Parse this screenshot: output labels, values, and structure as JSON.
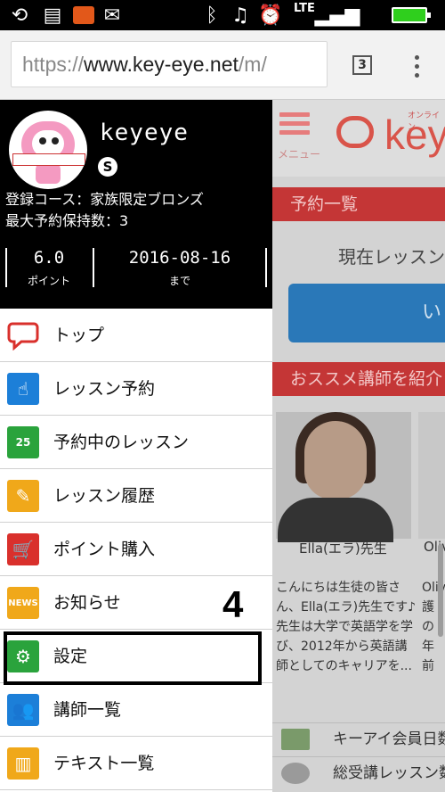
{
  "browser": {
    "url_scheme": "https://",
    "url_host": "www.key-eye.net",
    "url_path": "/m/",
    "tab_count": "3"
  },
  "status_bar": {
    "network": "LTE"
  },
  "background_page": {
    "menu_label": "メニュー",
    "logo_text": "key",
    "logo_small": "オンライン",
    "section_reservations": "予約一覧",
    "current_lesson_text": "現在レッスン",
    "blue_button_text": "い",
    "section_recommended": "おススメ講師を紹介",
    "teacher1_name": "Ella(エラ)先生",
    "teacher2_name": "Oliv",
    "teacher1_desc": "こんにちは生徒の皆さん、Ella(エラ)先生です♪ 先生は大学で英語学を学び、2012年から英語講師としてのキャリアを...",
    "teacher2_desc": "Olive 護の 年前 働い 力が",
    "list_item1": "キーアイ会員日数",
    "list_item2": "総受講レッスン数"
  },
  "profile": {
    "username": "keyeye",
    "course": "登録コース：家族限定ブロンズ",
    "max_reservations": "最大予約保持数：3",
    "points_value": "6.0",
    "points_label": "ポイント",
    "expiry_value": "2016-08-16",
    "expiry_label": "まで"
  },
  "menu": [
    {
      "label": "トップ",
      "icon": "speech-bubble-icon",
      "color": "#d9302c"
    },
    {
      "label": "レッスン予約",
      "icon": "touch-tablet-icon",
      "color": "#1c7fd8"
    },
    {
      "label": "予約中のレッスン",
      "icon": "calendar-icon",
      "color": "#2aa33c"
    },
    {
      "label": "レッスン履歴",
      "icon": "edit-note-icon",
      "color": "#f0a81a"
    },
    {
      "label": "ポイント購入",
      "icon": "cart-icon",
      "color": "#d9302c"
    },
    {
      "label": "お知らせ",
      "icon": "news-icon",
      "color": "#f0a81a"
    },
    {
      "label": "設定",
      "icon": "gear-icon",
      "color": "#2aa33c"
    },
    {
      "label": "講師一覧",
      "icon": "people-icon",
      "color": "#1c7fd8"
    },
    {
      "label": "テキスト一覧",
      "icon": "books-icon",
      "color": "#f0a81a"
    }
  ],
  "annotation": {
    "step_number": "4"
  }
}
